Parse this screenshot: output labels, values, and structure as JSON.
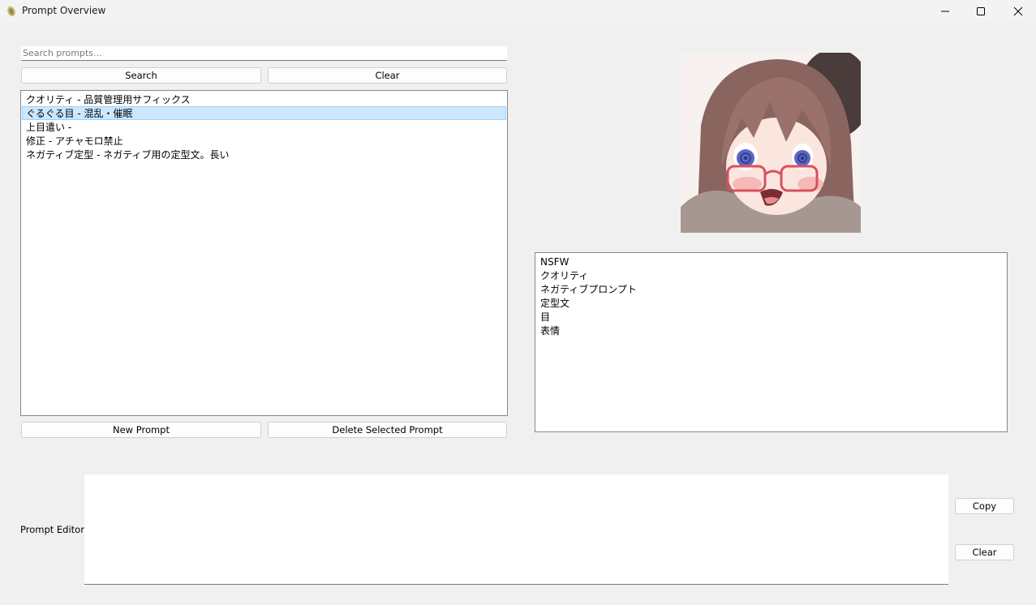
{
  "window": {
    "title": "Prompt Overview",
    "icons": [
      "app-icon",
      "minimize-icon",
      "maximize-icon",
      "close-icon"
    ]
  },
  "search": {
    "placeholder": "Search prompts...",
    "value": "",
    "search_label": "Search",
    "clear_label": "Clear"
  },
  "prompt_list": {
    "items": [
      {
        "label": "クオリティ - 品質管理用サフィックス",
        "selected": false
      },
      {
        "label": "ぐるぐる目 - 混乱・催眠",
        "selected": true
      },
      {
        "label": "上目遣い -",
        "selected": false
      },
      {
        "label": "修正 - アチャモロ禁止",
        "selected": false
      },
      {
        "label": "ネガティブ定型 - ネガティブ用の定型文。長い",
        "selected": false
      }
    ],
    "new_label": "New Prompt",
    "delete_label": "Delete Selected Prompt"
  },
  "tags": {
    "items": [
      "NSFW",
      "クオリティ",
      "ネガティブプロンプト",
      "定型文",
      "目",
      "表情"
    ]
  },
  "editor": {
    "label": "Prompt Editor:",
    "value": "",
    "copy_label": "Copy",
    "clear_label": "Clear"
  },
  "colors": {
    "background": "#f0f0f0",
    "selection": "#cce8ff",
    "selection_border": "#99d1ff"
  }
}
